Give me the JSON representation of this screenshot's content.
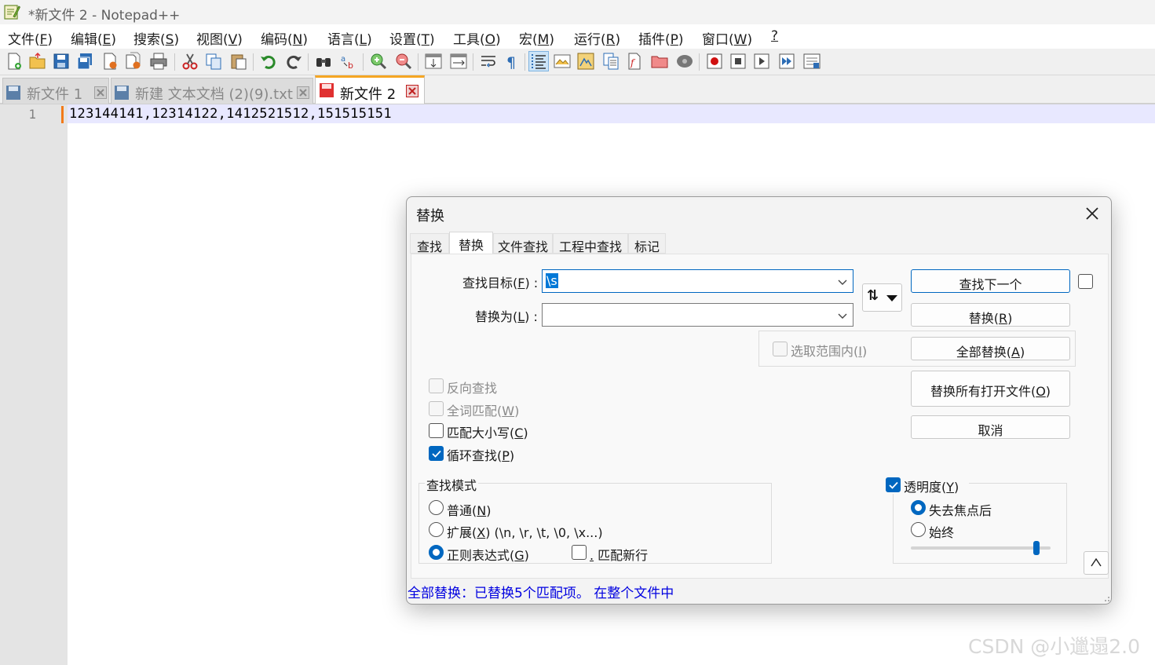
{
  "window": {
    "title": "*新文件 2 - Notepad++"
  },
  "menu": [
    {
      "text": "文件(",
      "key": "F",
      "end": ")"
    },
    {
      "text": "编辑(",
      "key": "E",
      "end": ")"
    },
    {
      "text": "搜索(",
      "key": "S",
      "end": ")"
    },
    {
      "text": "视图(",
      "key": "V",
      "end": ")"
    },
    {
      "text": "编码(",
      "key": "N",
      "end": ")"
    },
    {
      "text": "语言(",
      "key": "L",
      "end": ")"
    },
    {
      "text": "设置(",
      "key": "T",
      "end": ")"
    },
    {
      "text": "工具(",
      "key": "O",
      "end": ")"
    },
    {
      "text": "宏(",
      "key": "M",
      "end": ")"
    },
    {
      "text": "运行(",
      "key": "R",
      "end": ")"
    },
    {
      "text": "插件(",
      "key": "P",
      "end": ")"
    },
    {
      "text": "窗口(",
      "key": "W",
      "end": ")"
    },
    {
      "text": "",
      "key": "?",
      "end": ""
    }
  ],
  "toolbar_icons": [
    "new-file-icon",
    "open-file-icon",
    "save-icon",
    "save-all-icon",
    "close-icon",
    "close-all-icon",
    "print-icon",
    "cut-icon",
    "copy-icon",
    "paste-icon",
    "undo-icon",
    "redo-icon",
    "find-icon",
    "replace-icon",
    "zoom-in-icon",
    "zoom-out-icon",
    "sync-vertical-icon",
    "sync-horizontal-icon",
    "word-wrap-icon",
    "show-all-chars-icon",
    "indent-guide-icon",
    "udl-icon",
    "doc-map-icon",
    "doc-list-icon",
    "function-list-icon",
    "folder-workspace-icon",
    "monitor-icon",
    "record-macro-icon",
    "stop-macro-icon",
    "play-macro-icon",
    "run-macro-multiple-icon",
    "save-macro-icon"
  ],
  "tabs": [
    {
      "label": "新文件 1",
      "active": false
    },
    {
      "label": "新建 文本文档 (2)(9).txt",
      "active": false
    },
    {
      "label": "新文件 2",
      "active": true
    }
  ],
  "editor": {
    "line_number": "1",
    "line_text": "123144141,12314122,1412521512,151515151"
  },
  "dialog": {
    "title": "替换",
    "tabs": [
      "查找",
      "替换",
      "文件查找",
      "工程中查找",
      "标记"
    ],
    "active_tab": "替换",
    "find_label": {
      "text": "查找目标(",
      "key": "F",
      "end": ") :"
    },
    "find_value": "\\s",
    "replace_label": {
      "text": "替换为(",
      "key": "L",
      "end": ") :"
    },
    "replace_value": "",
    "swap_button": "⇅",
    "in_selection": {
      "text": "选取范围内(",
      "key": "I",
      "end": ")"
    },
    "buttons": {
      "find_next": "查找下一个",
      "replace": {
        "text": "替换(",
        "key": "R",
        "end": ")"
      },
      "replace_all": {
        "text": "全部替换(",
        "key": "A",
        "end": ")"
      },
      "replace_all_open": {
        "text": "替换所有打开文件(",
        "key": "O",
        "end": ")"
      },
      "cancel": "取消",
      "collapse": "^"
    },
    "options": {
      "backward": "反向查找",
      "whole_word": {
        "text": "全词匹配(",
        "key": "W",
        "end": ")"
      },
      "match_case": {
        "text": "匹配大小写(",
        "key": "C",
        "end": ")"
      },
      "wrap": {
        "text": "循环查找(",
        "key": "P",
        "end": ")"
      }
    },
    "search_mode": {
      "title": "查找模式",
      "normal": {
        "text": "普通(",
        "key": "N",
        "end": ")"
      },
      "extended": {
        "text": "扩展(",
        "key": "X",
        "end": ") (\\n, \\r, \\t, \\0, \\x...)"
      },
      "regex": {
        "text": "正则表达式(",
        "key": "G",
        "end": ")"
      },
      "dot_newline": {
        "key": ".",
        "text": " 匹配新行"
      }
    },
    "transparency": {
      "label": {
        "text": "透明度(",
        "key": "Y",
        "end": ")"
      },
      "on_lose_focus": "失去焦点后",
      "always": "始终",
      "level": 0.9
    },
    "status": "全部替换：已替换5个匹配项。 在整个文件中"
  },
  "watermark": "CSDN @小邋遢2.0",
  "colors": {
    "accent": "#0067c0",
    "status_text": "#0000e0",
    "current_line": "#e8e8ff",
    "active_tab_indicator": "#f5a623"
  }
}
